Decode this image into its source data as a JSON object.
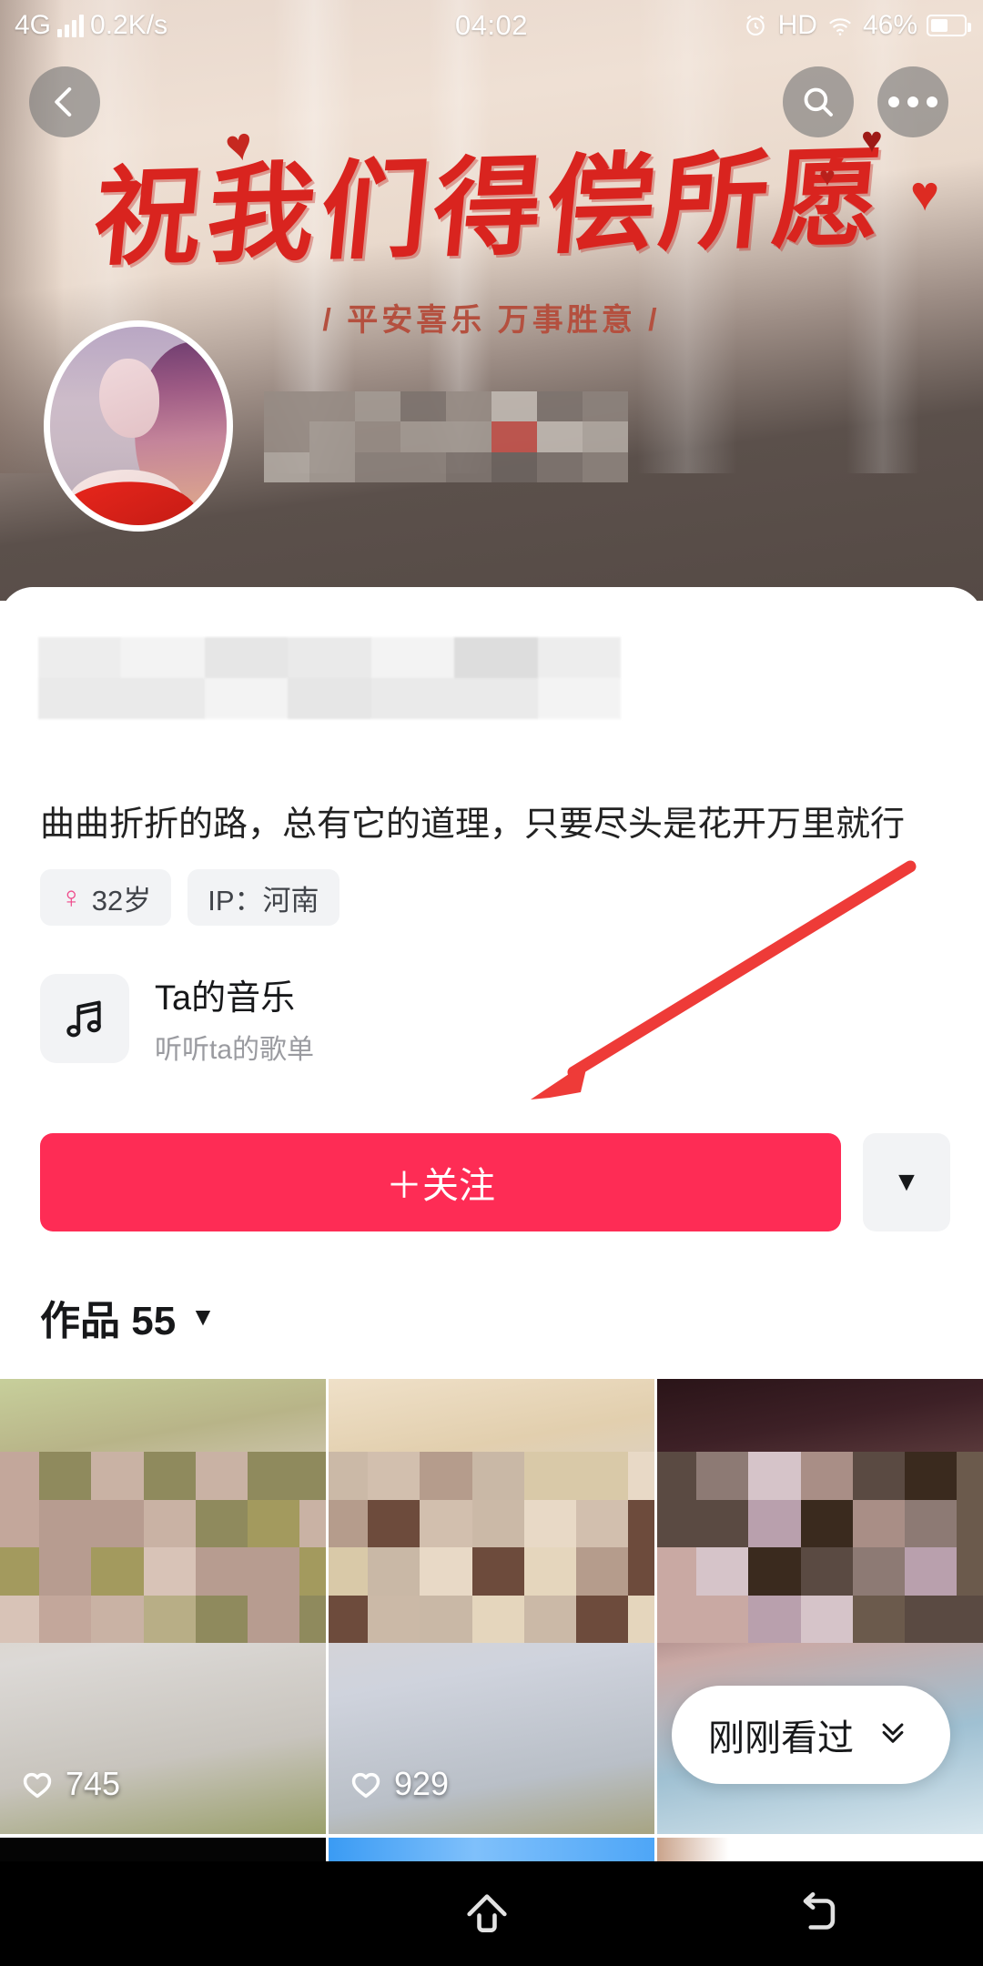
{
  "status_bar": {
    "network": "4G",
    "speed": "0.2K/s",
    "time": "04:02",
    "hd": "HD",
    "battery_percent": "46%",
    "signal_icon": "signal-bars-icon",
    "alarm_icon": "alarm-icon",
    "wifi_icon": "wifi-icon",
    "battery_icon": "battery-icon"
  },
  "header": {
    "back_icon": "back-chevron-icon",
    "search_icon": "search-icon",
    "more_icon": "more-dots-icon",
    "banner_title": "祝我们得偿所愿",
    "banner_subtitle": "/ 平安喜乐 万事胜意 /",
    "heart_glyph": "♥",
    "avatar_alt": "user-avatar",
    "nickname_censored": ""
  },
  "profile": {
    "bio": "曲曲折折的路，总有它的道理，只要尽头是花开万里就行",
    "tags": [
      {
        "icon": "female-gender-icon",
        "glyph": "♀",
        "label": "32岁"
      },
      {
        "icon": "",
        "glyph": "",
        "label": "IP：河南"
      }
    ],
    "music": {
      "icon": "music-note-icon",
      "glyph": "♫",
      "title": "Ta的音乐",
      "subtitle": "听听ta的歌单"
    },
    "follow_label": "＋关注",
    "follow_more_icon": "chevron-down-icon",
    "follow_more_glyph": "▼",
    "follow_color": "#fe2c55"
  },
  "works": {
    "label": "作品 55",
    "caret_glyph": "▼",
    "items": [
      {
        "like_count": "745",
        "like_icon": "heart-outline-icon"
      },
      {
        "like_count": "929",
        "like_icon": "heart-outline-icon"
      },
      {
        "like_count": "",
        "like_icon": "heart-outline-icon"
      }
    ]
  },
  "recent_pill": {
    "label": "刚刚看过",
    "icon": "double-chevron-down-icon",
    "glyph": "⌄"
  },
  "annotation": {
    "arrow_color": "#ee3b38",
    "description": "red-arrow-pointing-to-follow-button"
  },
  "navbar": {
    "recents_icon": "recents-menu-icon",
    "home_icon": "home-icon",
    "back_icon": "back-arrow-icon"
  }
}
